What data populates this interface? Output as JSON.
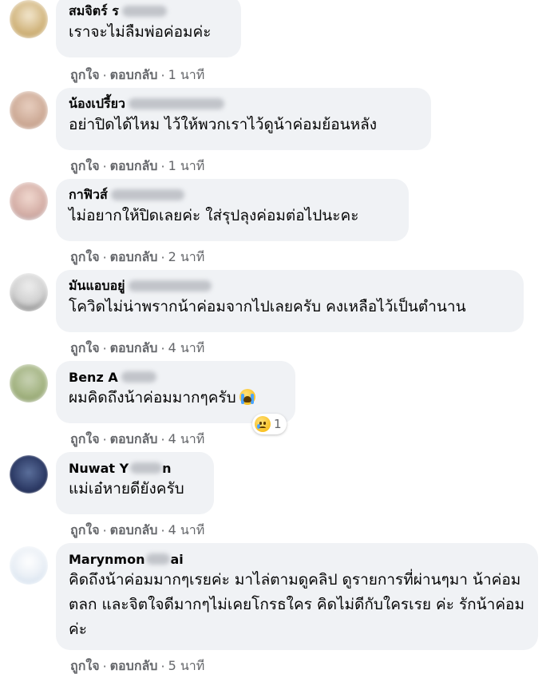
{
  "actions": {
    "like": "ถูกใจ",
    "reply": "ตอบกลับ",
    "sep": "·"
  },
  "comments": [
    {
      "author": "สมจิตร์ ร",
      "text": "เราจะไม่ลืมพ่อค่อมค่ะ",
      "time": "1 นาที"
    },
    {
      "author": "น้องเปรี้ยว",
      "text": "อย่าปิดได้ไหม ไว้ให้พวกเราไว้ดูน้าค่อมย้อนหลัง",
      "time": "1 นาที"
    },
    {
      "author": "กาฟิวส์",
      "text": "ไม่อยากให้ปิดเลยค่ะ ใส่รุปลุงค่อมต่อไปนะคะ",
      "time": "2 นาที"
    },
    {
      "author": "มันแอบอยู่",
      "text": "โควิดไม่น่าพรากน้าค่อมจากไปเลยครับ คงเหลือไว้เป็นตำนาน",
      "time": "4 นาที"
    },
    {
      "author": "Benz A",
      "text": "ผมคิดถึงน้าค่อมมากๆครับ",
      "time": "4 นาที",
      "reaction_count": "1",
      "text_emoji": "loudly-crying-face-icon",
      "reaction_icon": "sad-face-icon"
    },
    {
      "author": "Nuwat Y",
      "author_tail": "n",
      "text": "แม่เอ๋หายดียังครับ",
      "time": "4 นาที"
    },
    {
      "author": "Marynmon",
      "author_tail": "ai",
      "text": "คิดถึงน้าค่อมมากๆเรยค่ะ มาไล่ตามดูคลิป ดูรายการที่ผ่านๆมา น้าค่อมตลก และจิตใจดีมากๆไม่เคยโกรธใคร คิดไม่ดีกับใครเรย ค่ะ รักน้าค่อมค่ะ",
      "time": "5 นาที"
    }
  ],
  "colors": {
    "bubble": "#f0f2f5",
    "secondary_text": "#65676b",
    "primary_text": "#050505"
  }
}
